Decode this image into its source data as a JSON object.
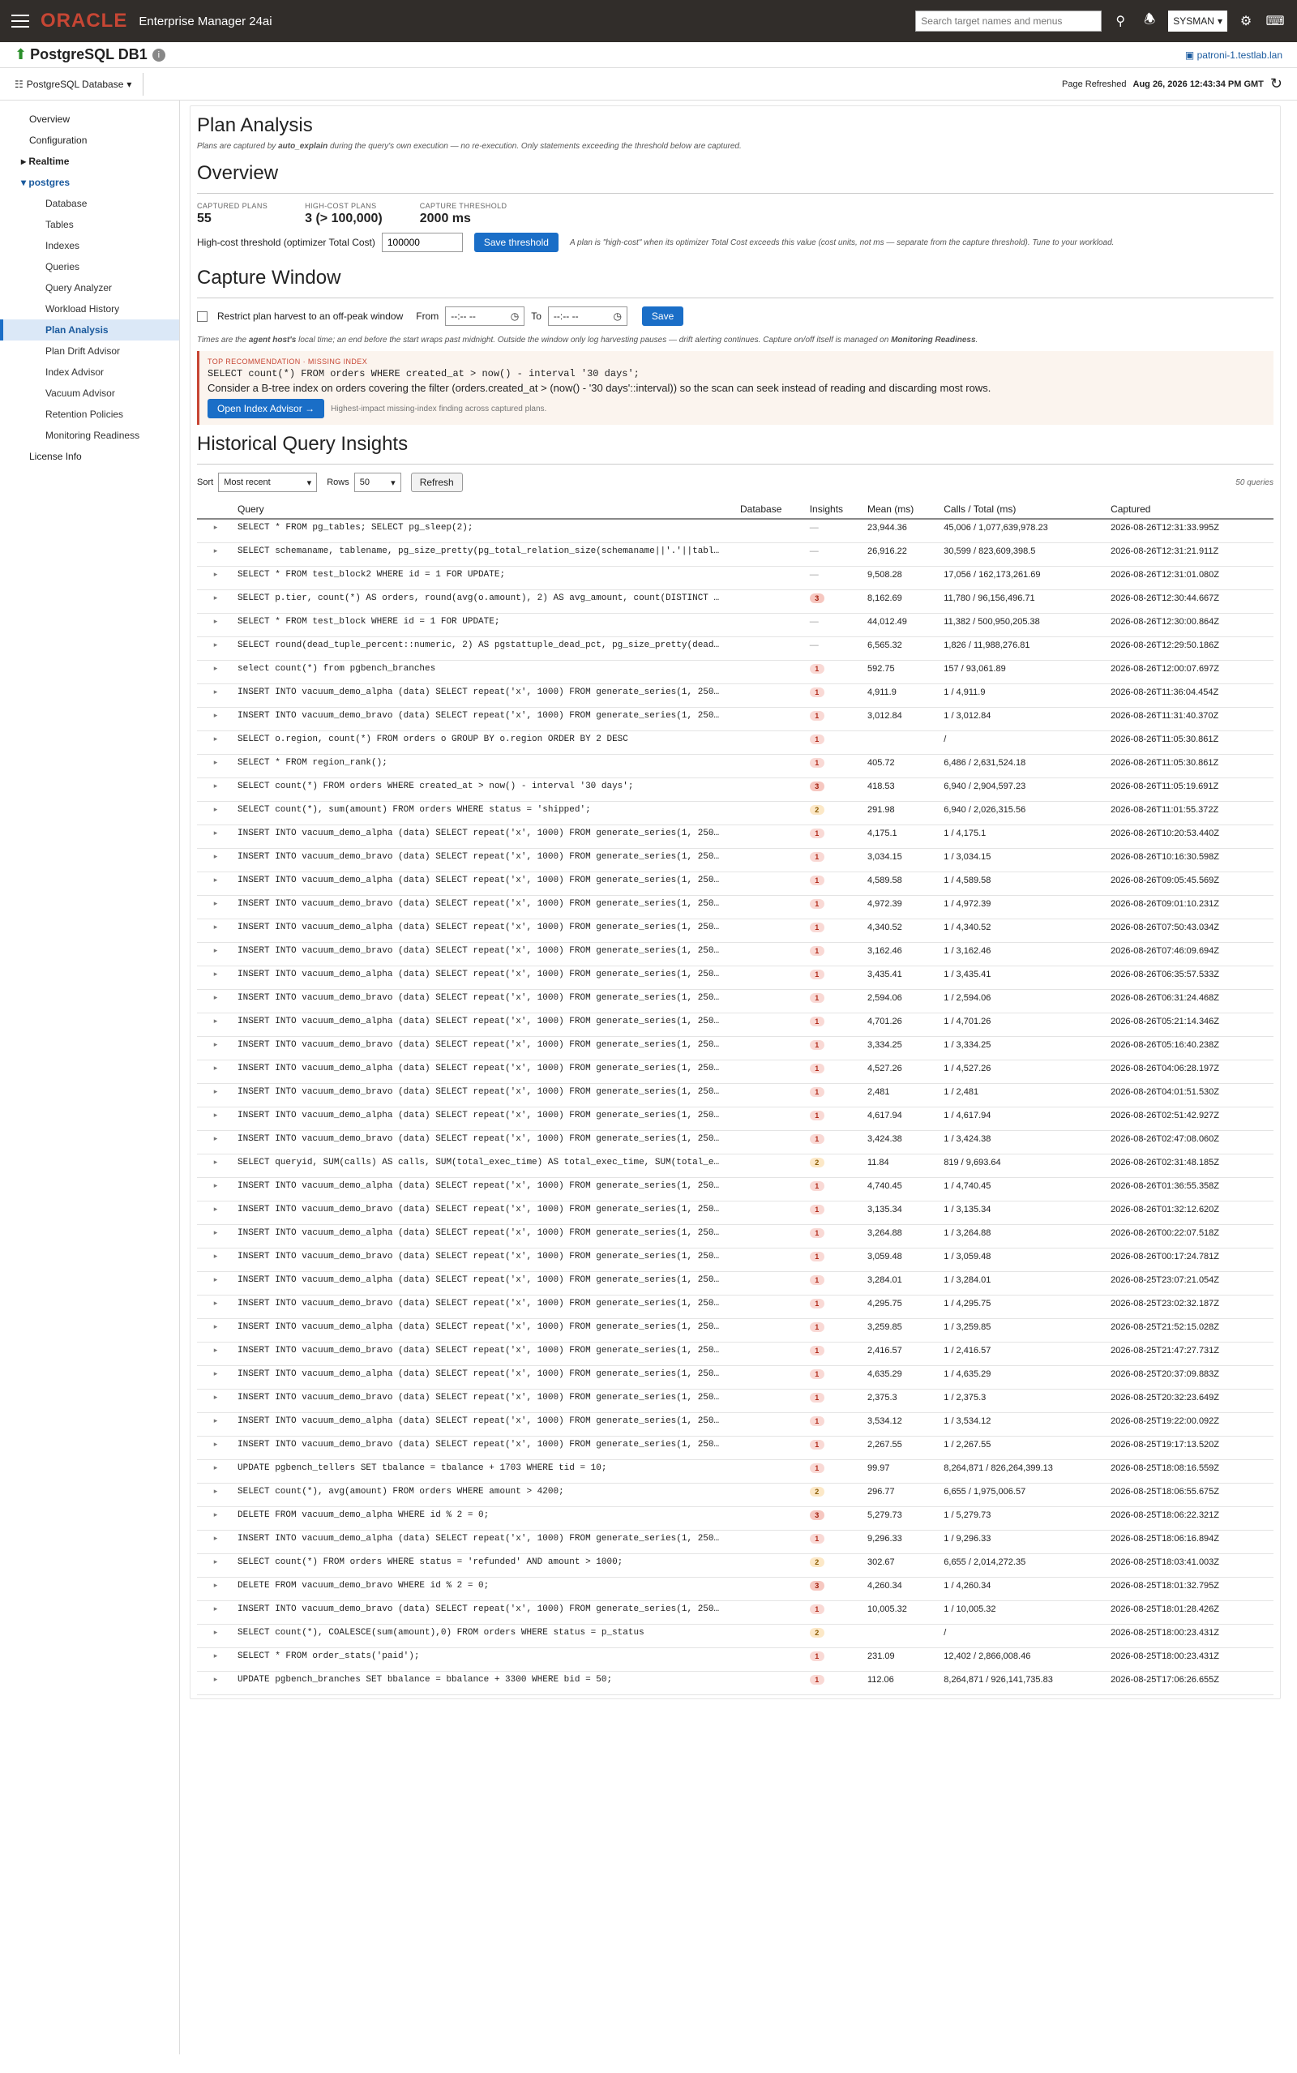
{
  "topbar": {
    "brand": "ORACLE",
    "product": "Enterprise Manager 24ai",
    "search_placeholder": "Search target names and menus",
    "user": "SYSMAN"
  },
  "target": {
    "name": "PostgreSQL DB1",
    "host": "patroni-1.testlab.lan",
    "menu": "PostgreSQL Database",
    "refreshed_label": "Page Refreshed",
    "refreshed_value": "Aug 26, 2026 12:43:34 PM GMT"
  },
  "sidebar": [
    {
      "label": "Overview",
      "cls": "l1"
    },
    {
      "label": "Configuration",
      "cls": "l1"
    },
    {
      "label": "Realtime",
      "cls": "grp"
    },
    {
      "label": "postgres",
      "cls": "grp open"
    },
    {
      "label": "Database",
      "cls": "l2"
    },
    {
      "label": "Tables",
      "cls": "l2"
    },
    {
      "label": "Indexes",
      "cls": "l2"
    },
    {
      "label": "Queries",
      "cls": "l2"
    },
    {
      "label": "Query Analyzer",
      "cls": "l2"
    },
    {
      "label": "Workload History",
      "cls": "l2"
    },
    {
      "label": "Plan Analysis",
      "cls": "l2 active"
    },
    {
      "label": "Plan Drift Advisor",
      "cls": "l2"
    },
    {
      "label": "Index Advisor",
      "cls": "l2"
    },
    {
      "label": "Vacuum Advisor",
      "cls": "l2"
    },
    {
      "label": "Retention Policies",
      "cls": "l2"
    },
    {
      "label": "Monitoring Readiness",
      "cls": "l2"
    },
    {
      "label": "License Info",
      "cls": "l1"
    }
  ],
  "page": {
    "title": "Plan Analysis",
    "note_pre": "Plans are captured by ",
    "note_bold": "auto_explain",
    "note_post": " during the query's own execution — no re-execution. Only statements exceeding the threshold below are captured.",
    "overview_title": "Overview",
    "kpis": [
      {
        "label": "CAPTURED PLANS",
        "value": "55"
      },
      {
        "label": "HIGH-COST PLANS",
        "value": "3 (> 100,000)"
      },
      {
        "label": "CAPTURE THRESHOLD",
        "value": "2000 ms"
      }
    ],
    "threshold_label": "High-cost threshold (optimizer Total Cost)",
    "threshold_value": "100000",
    "save_threshold": "Save threshold",
    "threshold_note": "A plan is \"high-cost\" when its optimizer Total Cost exceeds this value (cost units, not ms — separate from the capture threshold). Tune to your workload.",
    "capture_title": "Capture Window",
    "restrict_label": "Restrict plan harvest to an off-peak window",
    "from_label": "From",
    "to_label": "To",
    "time_placeholder": "--:-- --",
    "save": "Save",
    "capture_note_pre": "Times are the ",
    "capture_note_b1": "agent host's",
    "capture_note_mid": " local time; an end before the start wraps past midnight. Outside the window only log harvesting pauses — drift alerting continues. Capture on/off itself is managed on ",
    "capture_note_b2": "Monitoring Readiness",
    "capture_note_end": ".",
    "reco_tag": "TOP RECOMMENDATION · MISSING INDEX",
    "reco_sql": "SELECT count(*) FROM orders WHERE created_at > now() - interval '30 days';",
    "reco_msg": "Consider a B-tree index on orders covering the filter (orders.created_at > (now() - '30 days'::interval)) so the scan can seek instead of reading and discarding most rows.",
    "reco_button": "Open Index Advisor →",
    "reco_note": "Highest-impact missing-index finding across captured plans.",
    "history_title": "Historical Query Insights",
    "sort_label": "Sort",
    "sort_value": "Most recent",
    "rows_label": "Rows",
    "rows_value": "50",
    "refresh": "Refresh",
    "query_count": "50 queries",
    "columns": [
      "Query",
      "Database",
      "Insights",
      "Mean (ms)",
      "Calls / Total (ms)",
      "Captured"
    ]
  },
  "rows": [
    [
      "SELECT * FROM pg_tables; SELECT pg_sleep(2);",
      "",
      "—",
      "23,944.36",
      "45,006 / 1,077,639,978.23",
      "2026-08-26T12:31:33.995Z"
    ],
    [
      "SELECT schemaname, tablename, pg_size_pretty(pg_total_relation_size(schemaname||'.'||tabl…",
      "",
      "—",
      "26,916.22",
      "30,599 / 823,609,398.5",
      "2026-08-26T12:31:21.911Z"
    ],
    [
      "SELECT * FROM test_block2 WHERE id = 1 FOR UPDATE;",
      "",
      "—",
      "9,508.28",
      "17,056 / 162,173,261.69",
      "2026-08-26T12:31:01.080Z"
    ],
    [
      "SELECT p.tier, count(*) AS orders, round(avg(o.amount), 2) AS avg_amount, count(DISTINCT …",
      "",
      "3",
      "8,162.69",
      "11,780 / 96,156,496.71",
      "2026-08-26T12:30:44.667Z"
    ],
    [
      "SELECT * FROM test_block WHERE id = 1 FOR UPDATE;",
      "",
      "—",
      "44,012.49",
      "11,382 / 500,950,205.38",
      "2026-08-26T12:30:00.864Z"
    ],
    [
      "SELECT round(dead_tuple_percent::numeric, 2) AS pgstattuple_dead_pct, pg_size_pretty(dead…",
      "",
      "—",
      "6,565.32",
      "1,826 / 11,988,276.81",
      "2026-08-26T12:29:50.186Z"
    ],
    [
      "select count(*) from pgbench_branches",
      "",
      "1",
      "592.75",
      "157 / 93,061.89",
      "2026-08-26T12:00:07.697Z"
    ],
    [
      "INSERT INTO vacuum_demo_alpha (data) SELECT repeat('x', 1000) FROM generate_series(1, 250…",
      "",
      "1",
      "4,911.9",
      "1 / 4,911.9",
      "2026-08-26T11:36:04.454Z"
    ],
    [
      "INSERT INTO vacuum_demo_bravo (data) SELECT repeat('x', 1000) FROM generate_series(1, 250…",
      "",
      "1",
      "3,012.84",
      "1 / 3,012.84",
      "2026-08-26T11:31:40.370Z"
    ],
    [
      "SELECT o.region, count(*) FROM orders o GROUP BY o.region ORDER BY 2 DESC",
      "",
      "1",
      "",
      "/",
      "2026-08-26T11:05:30.861Z"
    ],
    [
      "SELECT * FROM region_rank();",
      "",
      "1",
      "405.72",
      "6,486 / 2,631,524.18",
      "2026-08-26T11:05:30.861Z"
    ],
    [
      "SELECT count(*) FROM orders WHERE created_at > now() - interval '30 days';",
      "",
      "3",
      "418.53",
      "6,940 / 2,904,597.23",
      "2026-08-26T11:05:19.691Z"
    ],
    [
      "SELECT count(*), sum(amount) FROM orders WHERE status = 'shipped';",
      "",
      "2",
      "291.98",
      "6,940 / 2,026,315.56",
      "2026-08-26T11:01:55.372Z"
    ],
    [
      "INSERT INTO vacuum_demo_alpha (data) SELECT repeat('x', 1000) FROM generate_series(1, 250…",
      "",
      "1",
      "4,175.1",
      "1 / 4,175.1",
      "2026-08-26T10:20:53.440Z"
    ],
    [
      "INSERT INTO vacuum_demo_bravo (data) SELECT repeat('x', 1000) FROM generate_series(1, 250…",
      "",
      "1",
      "3,034.15",
      "1 / 3,034.15",
      "2026-08-26T10:16:30.598Z"
    ],
    [
      "INSERT INTO vacuum_demo_alpha (data) SELECT repeat('x', 1000) FROM generate_series(1, 250…",
      "",
      "1",
      "4,589.58",
      "1 / 4,589.58",
      "2026-08-26T09:05:45.569Z"
    ],
    [
      "INSERT INTO vacuum_demo_bravo (data) SELECT repeat('x', 1000) FROM generate_series(1, 250…",
      "",
      "1",
      "4,972.39",
      "1 / 4,972.39",
      "2026-08-26T09:01:10.231Z"
    ],
    [
      "INSERT INTO vacuum_demo_alpha (data) SELECT repeat('x', 1000) FROM generate_series(1, 250…",
      "",
      "1",
      "4,340.52",
      "1 / 4,340.52",
      "2026-08-26T07:50:43.034Z"
    ],
    [
      "INSERT INTO vacuum_demo_bravo (data) SELECT repeat('x', 1000) FROM generate_series(1, 250…",
      "",
      "1",
      "3,162.46",
      "1 / 3,162.46",
      "2026-08-26T07:46:09.694Z"
    ],
    [
      "INSERT INTO vacuum_demo_alpha (data) SELECT repeat('x', 1000) FROM generate_series(1, 250…",
      "",
      "1",
      "3,435.41",
      "1 / 3,435.41",
      "2026-08-26T06:35:57.533Z"
    ],
    [
      "INSERT INTO vacuum_demo_bravo (data) SELECT repeat('x', 1000) FROM generate_series(1, 250…",
      "",
      "1",
      "2,594.06",
      "1 / 2,594.06",
      "2026-08-26T06:31:24.468Z"
    ],
    [
      "INSERT INTO vacuum_demo_alpha (data) SELECT repeat('x', 1000) FROM generate_series(1, 250…",
      "",
      "1",
      "4,701.26",
      "1 / 4,701.26",
      "2026-08-26T05:21:14.346Z"
    ],
    [
      "INSERT INTO vacuum_demo_bravo (data) SELECT repeat('x', 1000) FROM generate_series(1, 250…",
      "",
      "1",
      "3,334.25",
      "1 / 3,334.25",
      "2026-08-26T05:16:40.238Z"
    ],
    [
      "INSERT INTO vacuum_demo_alpha (data) SELECT repeat('x', 1000) FROM generate_series(1, 250…",
      "",
      "1",
      "4,527.26",
      "1 / 4,527.26",
      "2026-08-26T04:06:28.197Z"
    ],
    [
      "INSERT INTO vacuum_demo_bravo (data) SELECT repeat('x', 1000) FROM generate_series(1, 250…",
      "",
      "1",
      "2,481",
      "1 / 2,481",
      "2026-08-26T04:01:51.530Z"
    ],
    [
      "INSERT INTO vacuum_demo_alpha (data) SELECT repeat('x', 1000) FROM generate_series(1, 250…",
      "",
      "1",
      "4,617.94",
      "1 / 4,617.94",
      "2026-08-26T02:51:42.927Z"
    ],
    [
      "INSERT INTO vacuum_demo_bravo (data) SELECT repeat('x', 1000) FROM generate_series(1, 250…",
      "",
      "1",
      "3,424.38",
      "1 / 3,424.38",
      "2026-08-26T02:47:08.060Z"
    ],
    [
      "SELECT queryid, SUM(calls) AS calls, SUM(total_exec_time) AS total_exec_time, SUM(total_e…",
      "",
      "2",
      "11.84",
      "819 / 9,693.64",
      "2026-08-26T02:31:48.185Z"
    ],
    [
      "INSERT INTO vacuum_demo_alpha (data) SELECT repeat('x', 1000) FROM generate_series(1, 250…",
      "",
      "1",
      "4,740.45",
      "1 / 4,740.45",
      "2026-08-26T01:36:55.358Z"
    ],
    [
      "INSERT INTO vacuum_demo_bravo (data) SELECT repeat('x', 1000) FROM generate_series(1, 250…",
      "",
      "1",
      "3,135.34",
      "1 / 3,135.34",
      "2026-08-26T01:32:12.620Z"
    ],
    [
      "INSERT INTO vacuum_demo_alpha (data) SELECT repeat('x', 1000) FROM generate_series(1, 250…",
      "",
      "1",
      "3,264.88",
      "1 / 3,264.88",
      "2026-08-26T00:22:07.518Z"
    ],
    [
      "INSERT INTO vacuum_demo_bravo (data) SELECT repeat('x', 1000) FROM generate_series(1, 250…",
      "",
      "1",
      "3,059.48",
      "1 / 3,059.48",
      "2026-08-26T00:17:24.781Z"
    ],
    [
      "INSERT INTO vacuum_demo_alpha (data) SELECT repeat('x', 1000) FROM generate_series(1, 250…",
      "",
      "1",
      "3,284.01",
      "1 / 3,284.01",
      "2026-08-25T23:07:21.054Z"
    ],
    [
      "INSERT INTO vacuum_demo_bravo (data) SELECT repeat('x', 1000) FROM generate_series(1, 250…",
      "",
      "1",
      "4,295.75",
      "1 / 4,295.75",
      "2026-08-25T23:02:32.187Z"
    ],
    [
      "INSERT INTO vacuum_demo_alpha (data) SELECT repeat('x', 1000) FROM generate_series(1, 250…",
      "",
      "1",
      "3,259.85",
      "1 / 3,259.85",
      "2026-08-25T21:52:15.028Z"
    ],
    [
      "INSERT INTO vacuum_demo_bravo (data) SELECT repeat('x', 1000) FROM generate_series(1, 250…",
      "",
      "1",
      "2,416.57",
      "1 / 2,416.57",
      "2026-08-25T21:47:27.731Z"
    ],
    [
      "INSERT INTO vacuum_demo_alpha (data) SELECT repeat('x', 1000) FROM generate_series(1, 250…",
      "",
      "1",
      "4,635.29",
      "1 / 4,635.29",
      "2026-08-25T20:37:09.883Z"
    ],
    [
      "INSERT INTO vacuum_demo_bravo (data) SELECT repeat('x', 1000) FROM generate_series(1, 250…",
      "",
      "1",
      "2,375.3",
      "1 / 2,375.3",
      "2026-08-25T20:32:23.649Z"
    ],
    [
      "INSERT INTO vacuum_demo_alpha (data) SELECT repeat('x', 1000) FROM generate_series(1, 250…",
      "",
      "1",
      "3,534.12",
      "1 / 3,534.12",
      "2026-08-25T19:22:00.092Z"
    ],
    [
      "INSERT INTO vacuum_demo_bravo (data) SELECT repeat('x', 1000) FROM generate_series(1, 250…",
      "",
      "1",
      "2,267.55",
      "1 / 2,267.55",
      "2026-08-25T19:17:13.520Z"
    ],
    [
      "UPDATE pgbench_tellers SET tbalance = tbalance + 1703 WHERE tid = 10;",
      "",
      "1",
      "99.97",
      "8,264,871 / 826,264,399.13",
      "2026-08-25T18:08:16.559Z"
    ],
    [
      "SELECT count(*), avg(amount) FROM orders WHERE amount > 4200;",
      "",
      "2",
      "296.77",
      "6,655 / 1,975,006.57",
      "2026-08-25T18:06:55.675Z"
    ],
    [
      "DELETE FROM vacuum_demo_alpha WHERE id % 2 = 0;",
      "",
      "3",
      "5,279.73",
      "1 / 5,279.73",
      "2026-08-25T18:06:22.321Z"
    ],
    [
      "INSERT INTO vacuum_demo_alpha (data) SELECT repeat('x', 1000) FROM generate_series(1, 250…",
      "",
      "1",
      "9,296.33",
      "1 / 9,296.33",
      "2026-08-25T18:06:16.894Z"
    ],
    [
      "SELECT count(*) FROM orders WHERE status = 'refunded' AND amount > 1000;",
      "",
      "2",
      "302.67",
      "6,655 / 2,014,272.35",
      "2026-08-25T18:03:41.003Z"
    ],
    [
      "DELETE FROM vacuum_demo_bravo WHERE id % 2 = 0;",
      "",
      "3",
      "4,260.34",
      "1 / 4,260.34",
      "2026-08-25T18:01:32.795Z"
    ],
    [
      "INSERT INTO vacuum_demo_bravo (data) SELECT repeat('x', 1000) FROM generate_series(1, 250…",
      "",
      "1",
      "10,005.32",
      "1 / 10,005.32",
      "2026-08-25T18:01:28.426Z"
    ],
    [
      "SELECT count(*), COALESCE(sum(amount),0) FROM orders WHERE status = p_status",
      "",
      "2",
      "",
      "/",
      "2026-08-25T18:00:23.431Z"
    ],
    [
      "SELECT * FROM order_stats('paid');",
      "",
      "1",
      "231.09",
      "12,402 / 2,866,008.46",
      "2026-08-25T18:00:23.431Z"
    ],
    [
      "UPDATE pgbench_branches SET bbalance = bbalance + 3300 WHERE bid = 50;",
      "",
      "1",
      "112.06",
      "8,264,871 / 926,141,735.83",
      "2026-08-25T17:06:26.655Z"
    ]
  ]
}
